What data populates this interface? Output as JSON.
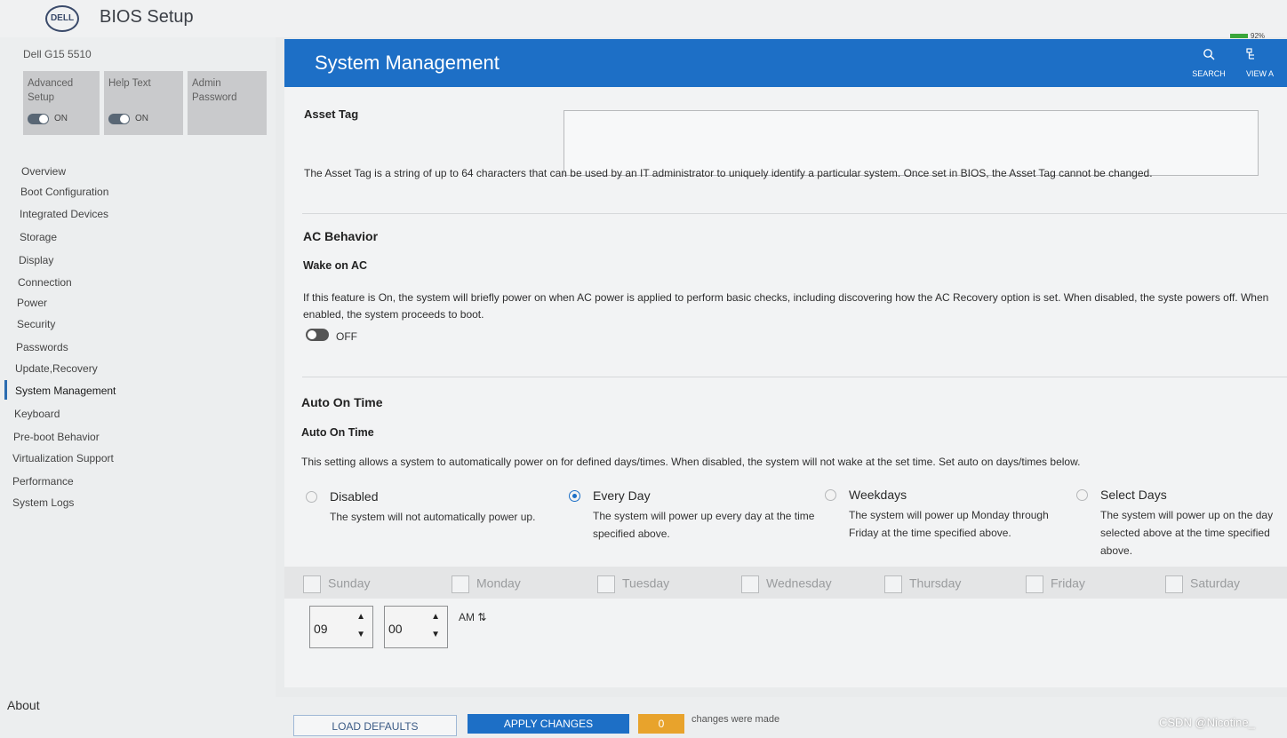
{
  "app": {
    "logo": "DELL",
    "title": "BIOS Setup"
  },
  "sidebar": {
    "model": "Dell G15 5510",
    "tiles": [
      {
        "label": "Advanced Setup",
        "state": "ON"
      },
      {
        "label": "Help Text",
        "state": "ON"
      },
      {
        "label": "Admin Password"
      }
    ],
    "items": [
      "Overview",
      "Boot Configuration",
      "Integrated Devices",
      "Storage",
      "Display",
      "Connection",
      "Power",
      "Security",
      "Passwords",
      "Update,Recovery",
      "System Management",
      "Keyboard",
      "Pre-boot Behavior",
      "Virtualization Support",
      "Performance",
      "System Logs"
    ],
    "active_item": "System Management",
    "about": "About"
  },
  "header": {
    "title": "System Management",
    "search_label": "SEARCH",
    "view_label": "VIEW A",
    "battery": "92%"
  },
  "asset_tag": {
    "heading": "Asset Tag",
    "value": "",
    "description": "The Asset Tag is a string of up to 64 characters that can be used by an IT administrator to uniquely identify a particular system. Once set in BIOS, the Asset Tag cannot be changed."
  },
  "ac_behavior": {
    "heading": "AC Behavior",
    "subheading": "Wake on AC",
    "description": "If this feature is On, the system will briefly power on when AC power is applied to perform basic checks, including discovering how the AC Recovery option is set. When disabled, the syste powers off. When enabled, the system proceeds to boot.",
    "state": "OFF"
  },
  "auto_on": {
    "heading": "Auto On Time",
    "subheading": "Auto On Time",
    "description": "This setting allows a system to automatically power on for defined days/times. When disabled, the system will not wake at the set time. Set auto on days/times below.",
    "options": [
      {
        "title": "Disabled",
        "desc": "The system will not automatically power up.",
        "selected": false
      },
      {
        "title": "Every Day",
        "desc": "The system will power up every day at the time specified above.",
        "selected": true
      },
      {
        "title": "Weekdays",
        "desc": "The system will power up Monday through Friday at the time specified above.",
        "selected": false
      },
      {
        "title": "Select Days",
        "desc": "The system will power up on the day selected above at the time specified above.",
        "selected": false
      }
    ],
    "days": [
      "Sunday",
      "Monday",
      "Tuesday",
      "Wednesday",
      "Thursday",
      "Friday",
      "Saturday"
    ],
    "hour": "09",
    "minute": "00",
    "ampm": "AM ⇅"
  },
  "footer": {
    "load_defaults": "LOAD DEFAULTS",
    "apply_changes": "APPLY CHANGES",
    "changes_count": "0",
    "changes_text": "changes were made"
  },
  "watermark": "CSDN @Nicotine_"
}
